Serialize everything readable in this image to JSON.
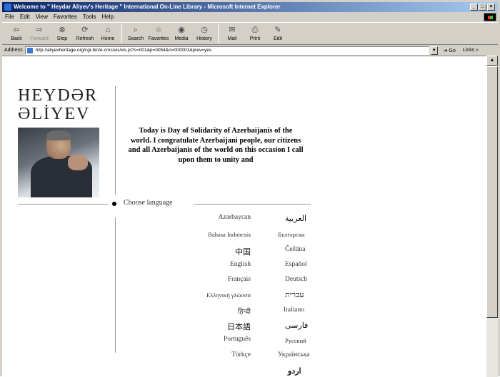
{
  "window": {
    "title": "Welcome to \" Heydar Aliyev's Heritage \" International On-Line Library - Microsoft Internet Explorer",
    "controls": [
      "_",
      "□",
      "×"
    ]
  },
  "menu": [
    "File",
    "Edit",
    "View",
    "Favorites",
    "Tools",
    "Help"
  ],
  "toolbar": [
    {
      "label": "Back",
      "icon": "back-arrow-icon",
      "glyph": "⇦"
    },
    {
      "label": "Forward",
      "icon": "forward-arrow-icon",
      "glyph": "⇨"
    },
    {
      "label": "Stop",
      "icon": "stop-icon",
      "glyph": "⊗"
    },
    {
      "label": "Refresh",
      "icon": "refresh-icon",
      "glyph": "⟳"
    },
    {
      "label": "Home",
      "icon": "home-icon",
      "glyph": "⌂"
    },
    {
      "label": "Search",
      "icon": "search-icon",
      "glyph": "⌕"
    },
    {
      "label": "Favorites",
      "icon": "favorites-icon",
      "glyph": "☆"
    },
    {
      "label": "Media",
      "icon": "media-icon",
      "glyph": "◉"
    },
    {
      "label": "History",
      "icon": "history-icon",
      "glyph": "◷"
    },
    {
      "label": "Mail",
      "icon": "mail-icon",
      "glyph": "✉"
    },
    {
      "label": "Print",
      "icon": "print-icon",
      "glyph": "⎙"
    },
    {
      "label": "Edit",
      "icon": "edit-icon",
      "glyph": "✎"
    }
  ],
  "address": {
    "label": "Address",
    "url": "http://aliyevheritage.org/cgi-bin/e-cms/vis/vis.pl?s=001&p=0054&n=000001&prev=yes",
    "go": "Go",
    "links": "Links »"
  },
  "page": {
    "logo_line1": "HEYDƏR",
    "logo_line2": "ƏLİYEV",
    "quote": "Today is Day of Solidarity of Azerbaijanis of the world. I congratulate Azerbaijani people, our citizens and all Azerbaijanis of the world on this occasion I call upon them to unity and",
    "choose_language": "Choose language",
    "languages_left": [
      "Azərbaycan",
      "Bahasa Indonesia",
      "中国",
      "English",
      "Français",
      "Ελληνική γλώσσα",
      "हिन्दी",
      "日本語",
      "Português",
      "Türkçe"
    ],
    "languages_right": [
      "العربية",
      "Български",
      "Čeština",
      "Español",
      "Deutsch",
      "עברית",
      "Italiano",
      "فارسی",
      "Русский",
      "Українська",
      "اردو"
    ]
  },
  "colors": {
    "titlebar_start": "#0a246a",
    "titlebar_end": "#a6caf0",
    "chrome": "#d4d0c8"
  }
}
